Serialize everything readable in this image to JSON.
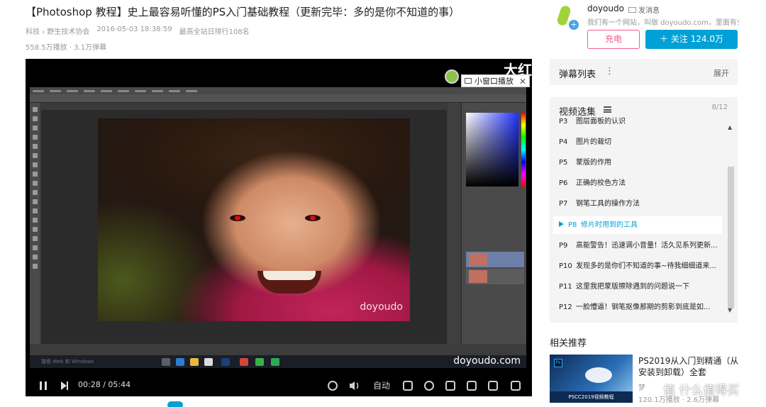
{
  "video": {
    "title": "【Photoshop 教程】史上最容易听懂的PS入门基础教程（更新完毕：多的是你不知道的事）",
    "category": "科技",
    "subcategory": "野生技术协会",
    "date": "2016-05-03 18:38:59",
    "rank": "最高全站日排行108名",
    "plays": "558.5万播放",
    "danmu": "3.1万弹幕"
  },
  "player": {
    "big_watermark": "大红",
    "mini_window_label": "小窗口播放",
    "photo_watermark": "doyoudo",
    "corner_watermark": "doyoudo.com",
    "taskbar_search": "搜索 Web 和 Windows",
    "current_time": "00:28",
    "duration": "05:44",
    "auto_label": "自动"
  },
  "author": {
    "name": "doyoudo",
    "message_label": "发消息",
    "signature": "我们有一个网站，叫做 doyoudo.com，里面有全部的教程",
    "charge_label": "充电",
    "follow_label": "关注 124.0万"
  },
  "danmu_panel": {
    "title": "弹幕列表",
    "expand": "展开"
  },
  "episodes": {
    "title": "视频选集",
    "count": "8/12",
    "items": [
      {
        "p": "P3",
        "name": "图层面板的认识"
      },
      {
        "p": "P4",
        "name": "图片的裁切"
      },
      {
        "p": "P5",
        "name": "蒙版的作用"
      },
      {
        "p": "P6",
        "name": "正确的校色方法"
      },
      {
        "p": "P7",
        "name": "钢笔工具的操作方法"
      },
      {
        "p": "P8",
        "name": "修片时用到的工具"
      },
      {
        "p": "P9",
        "name": "高能警告！迅速调小音量！活久见系列更新..."
      },
      {
        "p": "P10",
        "name": "发现多的是你们不知道的事~待我细细道来..."
      },
      {
        "p": "P11",
        "name": "这里我把蒙版擦除遇到的问题说一下"
      },
      {
        "p": "P12",
        "name": "一脸懵逼！钢笔抠像那期的剪影到底是如..."
      }
    ]
  },
  "recommend": {
    "title": "相关推荐",
    "item_name": "PS2019从入门到精通（从安装到卸载）全套",
    "item_author": "梦",
    "item_stats": "120.1万播放 · 2.6万弹幕",
    "thumb_banner": "PSCC2019视频教程",
    "thumb_badge": "Ps"
  },
  "site_watermark": "值 什么值得买",
  "colors": {
    "accent": "#00a1d6",
    "charge": "#f25d8e",
    "panel_bg": "#f4f4f4"
  }
}
